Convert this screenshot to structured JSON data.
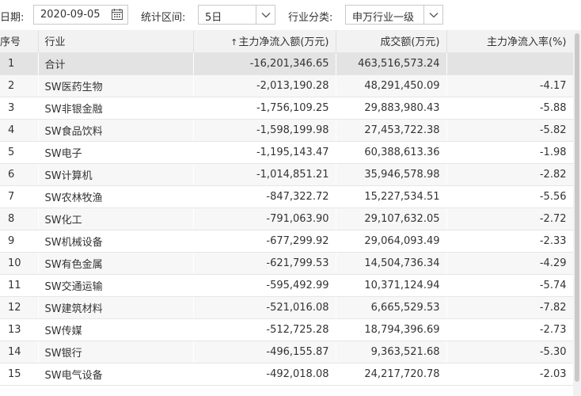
{
  "toolbar": {
    "date_label": "日期:",
    "date_value": "2020-09-05",
    "range_label": "统计区间:",
    "range_value": "5日",
    "category_label": "行业分类:",
    "category_value": "申万行业一级"
  },
  "table": {
    "headers": {
      "idx": "序号",
      "name": "行业",
      "net": "主力净流入额(万元)",
      "net_sort_arrow": "↑",
      "vol": "成交额(万元)",
      "rate": "主力净流入率(%)"
    },
    "rows": [
      {
        "idx": "1",
        "name": "合计",
        "net": "-16,201,346.65",
        "vol": "463,516,573.24",
        "rate": ""
      },
      {
        "idx": "2",
        "name": "SW医药生物",
        "net": "-2,013,190.28",
        "vol": "48,291,450.09",
        "rate": "-4.17"
      },
      {
        "idx": "3",
        "name": "SW非银金融",
        "net": "-1,756,109.25",
        "vol": "29,883,980.43",
        "rate": "-5.88"
      },
      {
        "idx": "4",
        "name": "SW食品饮料",
        "net": "-1,598,199.98",
        "vol": "27,453,722.38",
        "rate": "-5.82"
      },
      {
        "idx": "5",
        "name": "SW电子",
        "net": "-1,195,143.47",
        "vol": "60,388,613.36",
        "rate": "-1.98"
      },
      {
        "idx": "6",
        "name": "SW计算机",
        "net": "-1,014,851.21",
        "vol": "35,946,578.98",
        "rate": "-2.82"
      },
      {
        "idx": "7",
        "name": "SW农林牧渔",
        "net": "-847,322.72",
        "vol": "15,227,534.51",
        "rate": "-5.56"
      },
      {
        "idx": "8",
        "name": "SW化工",
        "net": "-791,063.90",
        "vol": "29,107,632.05",
        "rate": "-2.72"
      },
      {
        "idx": "9",
        "name": "SW机械设备",
        "net": "-677,299.92",
        "vol": "29,064,093.49",
        "rate": "-2.33"
      },
      {
        "idx": "10",
        "name": "SW有色金属",
        "net": "-621,799.53",
        "vol": "14,504,736.34",
        "rate": "-4.29"
      },
      {
        "idx": "11",
        "name": "SW交通运输",
        "net": "-595,492.99",
        "vol": "10,371,124.94",
        "rate": "-5.74"
      },
      {
        "idx": "12",
        "name": "SW建筑材料",
        "net": "-521,016.08",
        "vol": "6,665,529.53",
        "rate": "-7.82"
      },
      {
        "idx": "13",
        "name": "SW传媒",
        "net": "-512,725.28",
        "vol": "18,794,396.69",
        "rate": "-2.73"
      },
      {
        "idx": "14",
        "name": "SW银行",
        "net": "-496,155.87",
        "vol": "9,363,521.68",
        "rate": "-5.30"
      },
      {
        "idx": "15",
        "name": "SW电气设备",
        "net": "-492,018.08",
        "vol": "24,217,720.78",
        "rate": "-2.03"
      }
    ]
  }
}
